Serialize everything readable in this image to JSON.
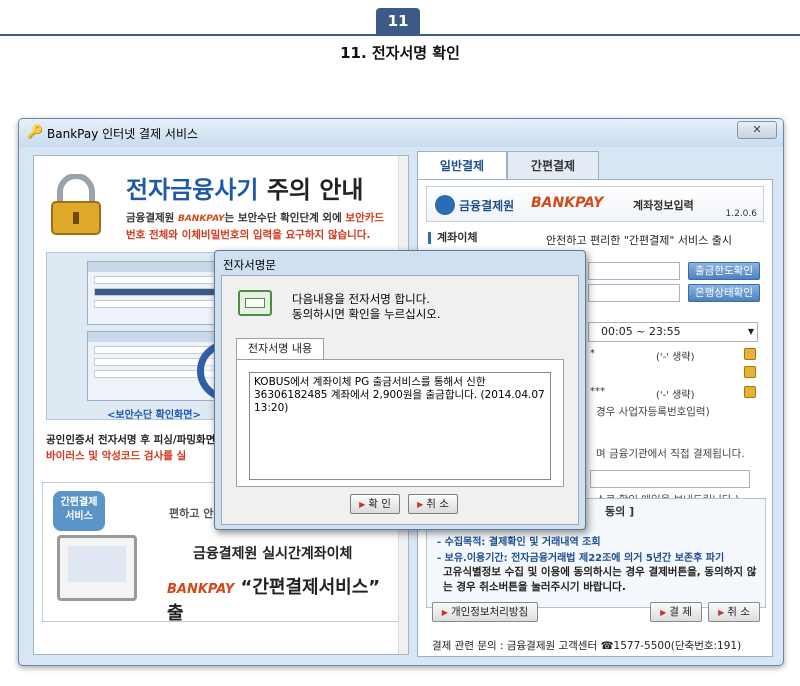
{
  "header": {
    "page_number": "11",
    "title": "11. 전자서명 확인"
  },
  "window": {
    "title": "BankPay 인터넷 결제 서비스",
    "close_label": "✕"
  },
  "left_panel": {
    "notice_title_blue": "전자금융사기",
    "notice_title_rest": " 주의 안내",
    "notice_line1_a": "금융결제원 ",
    "notice_bankpay": "BANKPAY",
    "notice_line1_b": "는 보안수단 확인단계 외에 ",
    "notice_line1_red": "보안카드",
    "notice_line2_red": "번호 전체와 이체비밀번호의 입력을 요구하지 않습니다.",
    "sample_caption": "<보안수단 확인화면>",
    "warn_line1": "공인인증서 전자서명 후 피싱/파밍화면",
    "warn_line2": "바이러스 및 악성코드 검사를 실",
    "promo_badge_1": "간편결제",
    "promo_badge_2": "서비스",
    "promo_sub": "편하고 안전",
    "promo_line1": "금융결제원 실시간계좌이체",
    "promo_bankpay": "BANKPAY",
    "promo_line2": "“간편결제서비스” 출"
  },
  "tabs": {
    "general": "일반결제",
    "simple": "간편결제"
  },
  "right_panel": {
    "brand_name": "금융결제원",
    "brand_bankpay": "BANKPAY",
    "brand_title": "계좌정보입력",
    "version": "1.2.0.6",
    "section_label": "계좌이체",
    "service_note": "안전하고 편리한 \"간편결제\" 서비스 출시",
    "btn_limit": "출금한도확인",
    "btn_bank_status": "은행상태확인",
    "time_range": "00:05 ~ 23:55",
    "masked_1": "*",
    "omit_1": "('-' 생략)",
    "masked_2": "***",
    "omit_2": "('-' 생략)",
    "biz_note": "경우 사업자등록번호입력)",
    "direct_note": "며 금융기관에서 직접 결제됩니다.",
    "mail_note": "소로 확인 메일을 보내드립니다.)",
    "consent_head": "동의 ]",
    "consent_item1": "- 수집목적: 결제확인 및 거래내역 조회",
    "consent_item2": "- 보유.이용기간: 전자금융거래법 제22조에 의거 5년간 보존후 파기",
    "consent_body": "고유식별정보 수집 및 이용에 동의하시는 경우 결제버튼을, 동의하지 않는 경우 취소버튼을 눌러주시기 바랍니다.",
    "btn_privacy": "개인정보처리방침",
    "btn_pay": "결 제",
    "btn_cancel": "취 소",
    "footer": "결제 관련 문의 : 금융결제원 고객센터 ☎1577-5500(단축번호:191)"
  },
  "dialog": {
    "title": "전자서명문",
    "message_line1": "다음내용을 전자서명 합니다.",
    "message_line2": "동의하시면 확인을 누르십시오.",
    "tab_label": "전자서명 내용",
    "content": "KOBUS에서 계좌이체 PG 출금서비스를 통해서 신한 36306182485 계좌에서 2,900원을 출금합니다. (2014.04.07 13:20)",
    "confirm": "확 인",
    "cancel": "취 소"
  }
}
